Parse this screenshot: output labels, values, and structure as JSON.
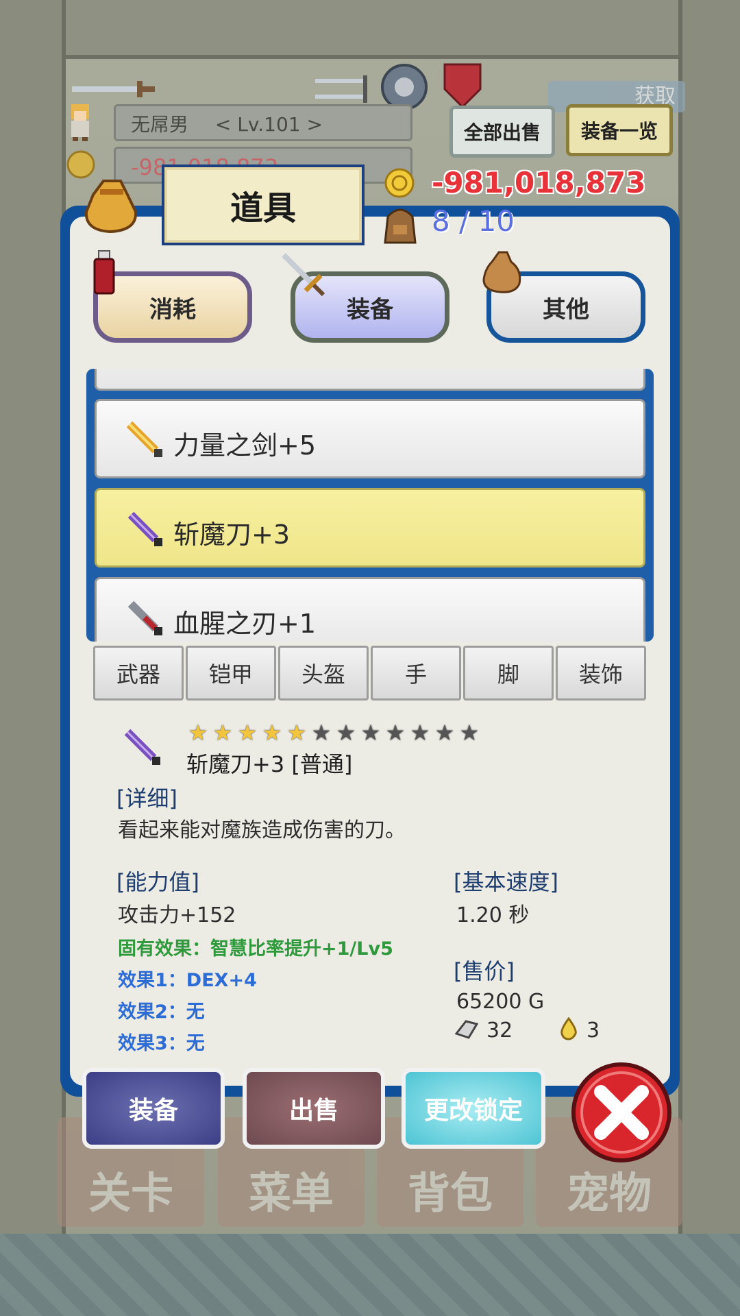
{
  "player": {
    "name": "无屌男",
    "level": "< Lv.101 >",
    "gold_faded": "-981,018,873"
  },
  "top_buttons": {
    "sell_all": "全部出售",
    "equip_list": "装备一览",
    "bg_sign": "获取"
  },
  "panel": {
    "title": "道具",
    "gold": "-981,018,873",
    "capacity": "8 / 10",
    "category_tabs": [
      {
        "label": "消耗",
        "icon": "potion-icon"
      },
      {
        "label": "装备",
        "icon": "sword-icon",
        "active": true
      },
      {
        "label": "其他",
        "icon": "sack-icon"
      }
    ]
  },
  "items": [
    {
      "name": "力量之剑+5",
      "icon": "gold-sword-icon",
      "selected": false
    },
    {
      "name": "斩魔刀+3",
      "icon": "purple-blade-icon",
      "selected": true
    },
    {
      "name": "血腥之刃+1",
      "icon": "red-blade-icon",
      "selected": false
    }
  ],
  "slot_tabs": [
    "武器",
    "铠甲",
    "头盔",
    "手",
    "脚",
    "装饰"
  ],
  "detail": {
    "stars_filled": 5,
    "stars_total": 12,
    "name": "斩魔刀+3 [普通]",
    "detail_header": "[详细]",
    "description": "看起来能对魔族造成伤害的刀。",
    "stats_header": "[能力值]",
    "attack": "攻击力+152",
    "innate": "固有效果：智慧比率提升+1/Lv5",
    "effect1": "效果1：DEX+4",
    "effect2": "效果2：无",
    "effect3": "效果3：无",
    "speed_header": "[基本速度]",
    "speed": "1.20 秒",
    "price_header": "[售价]",
    "price": "65200 G",
    "ore_count": "32",
    "drop_count": "3"
  },
  "actions": {
    "equip": "装备",
    "sell": "出售",
    "lock": "更改锁定"
  },
  "nav": [
    "关卡",
    "菜单",
    "背包",
    "宠物"
  ],
  "colors": {
    "panel_blue": "#10509a",
    "selected_row": "#f2ea8e",
    "gold_text": "#e8323a",
    "capacity_text": "#5b6fe0",
    "innate_green": "#2e9a3c",
    "effect_blue": "#2b6cd6"
  }
}
